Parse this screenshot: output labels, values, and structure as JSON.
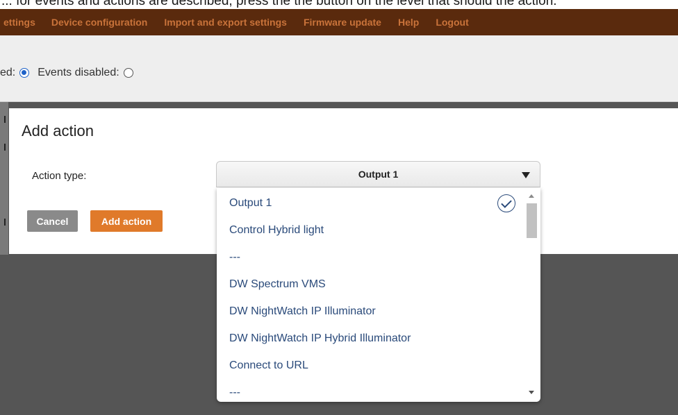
{
  "top_caption": "... for events and actions are described, press the the button on the level that should the action.",
  "navbar": {
    "items": [
      "ettings",
      "Device configuration",
      "Import and export settings",
      "Firmware update",
      "Help",
      "Logout"
    ]
  },
  "events": {
    "enabled_label_cut": "ed:",
    "disabled_label": "Events disabled:",
    "enabled_checked": true
  },
  "modal": {
    "title": "Add action",
    "action_type_label": "Action type:",
    "cancel_label": "Cancel",
    "add_label": "Add action"
  },
  "select": {
    "value": "Output 1",
    "options": [
      "Output 1",
      "Control Hybrid light",
      "---",
      "DW Spectrum VMS",
      "DW NightWatch IP Illuminator",
      "DW NightWatch IP Hybrid Illuminator",
      "Connect to URL",
      "---"
    ],
    "selected_index": 0
  },
  "colors": {
    "navbar_bg": "#5a2a0d",
    "nav_text": "#c9733a",
    "accent_orange": "#e07a2a",
    "cancel_gray": "#8a8a8a",
    "option_text": "#2a4a7a"
  }
}
